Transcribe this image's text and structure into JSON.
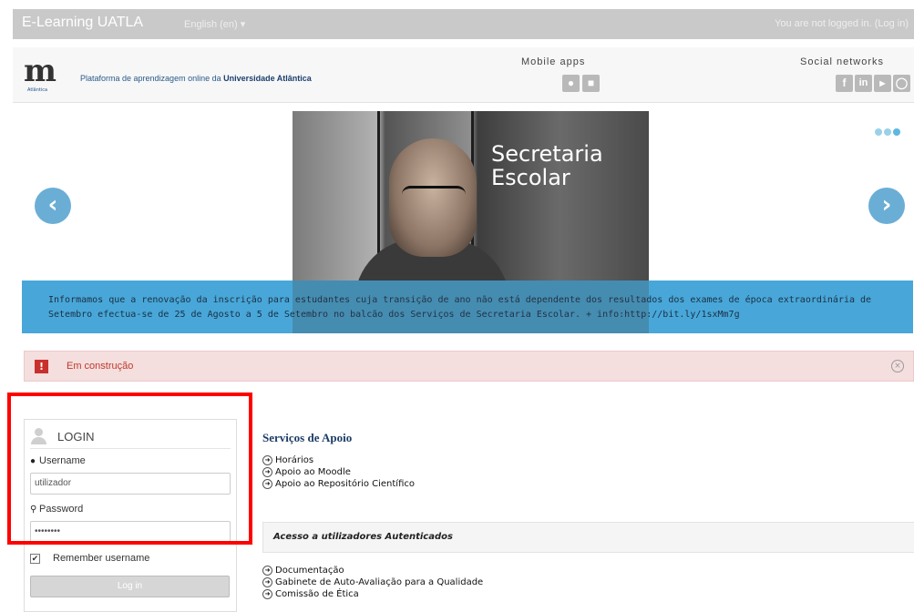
{
  "navbar": {
    "brand": "E-Learning UATLA",
    "language": "English (en) ▾",
    "login_status": "You are not logged in. (Log in)"
  },
  "header": {
    "logo_letter": "m",
    "logo_sub": "Atlântica",
    "tagline_prefix": "Plataforma de aprendizagem online da ",
    "tagline_bold": "Universidade Atlântica",
    "mobile_apps_title": "Mobile apps",
    "social_title": "Social networks",
    "mobile_icons": [
      "apple-icon",
      "android-icon"
    ],
    "social_icons": [
      "facebook-icon",
      "linkedin-icon",
      "youtube-icon",
      "other-social-icon"
    ]
  },
  "carousel": {
    "slide_title_line1": "Secretaria",
    "slide_title_line2": "Escolar",
    "prev_symbol": "‹",
    "next_symbol": "›",
    "banner_text": "Informamos que a renovação da inscrição para estudantes cuja transição de ano não está dependente dos resultados dos exames de época extraordinária de Setembro efectua-se de 25 de Agosto a 5 de Setembro no balcão dos Serviços de Secretaria Escolar. + info:http://bit.ly/1sxMm7g"
  },
  "alert": {
    "icon": "!",
    "text": "Em construção"
  },
  "login": {
    "title": "LOGIN",
    "username_label": "Username",
    "username_value": "utilizador",
    "password_label": "Password",
    "password_value": "••••••••",
    "remember_label": "Remember username",
    "remember_checked": "✔",
    "button_label": "Log in"
  },
  "services": {
    "title": "Serviços de Apoio",
    "links": [
      "Horários",
      "Apoio ao Moodle",
      "Apoio ao Repositório Científico"
    ]
  },
  "authenticated": {
    "title": "Acesso a utilizadores Autenticados",
    "links": [
      "Documentação",
      "Gabinete de Auto-Avaliação para a Qualidade",
      "Comissão de Ética"
    ]
  },
  "colors": {
    "banner": "#48a7d8",
    "alert_bg": "#f4dede",
    "highlight": "#ff0000"
  }
}
